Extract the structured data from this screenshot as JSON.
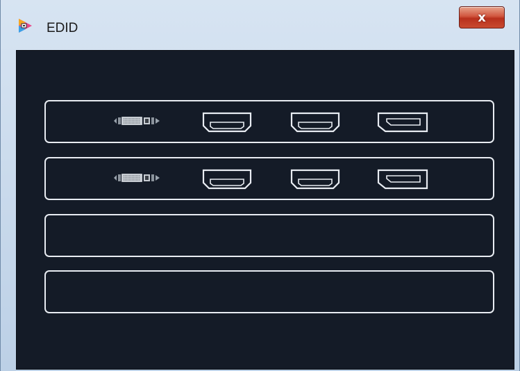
{
  "window": {
    "title": "EDID",
    "close_label": "x"
  },
  "rows": [
    {
      "ports": [
        "dvi-icon",
        "hdmi-icon",
        "hdmi-icon",
        "displayport-icon"
      ]
    },
    {
      "ports": [
        "dvi-icon",
        "hdmi-icon",
        "hdmi-icon",
        "displayport-icon"
      ]
    },
    {
      "ports": []
    },
    {
      "ports": []
    }
  ],
  "colors": {
    "panel_background": "#141b27",
    "row_border": "#e8ecf2"
  }
}
